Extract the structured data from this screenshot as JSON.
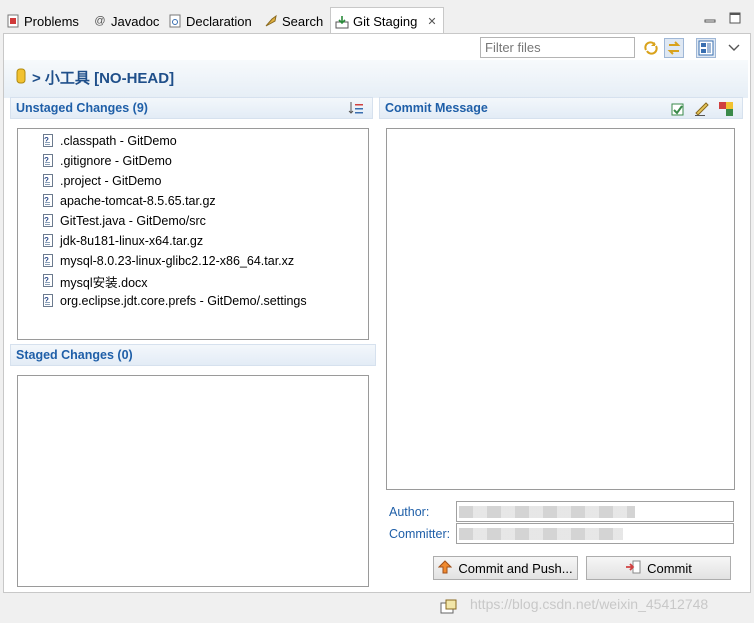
{
  "tabs": [
    {
      "label": "Problems",
      "icon": "problems-icon"
    },
    {
      "label": "Javadoc",
      "icon": "javadoc-icon"
    },
    {
      "label": "Declaration",
      "icon": "declaration-icon"
    },
    {
      "label": "Search",
      "icon": "search-icon"
    },
    {
      "label": "Git Staging",
      "icon": "git-staging-icon",
      "active": true
    }
  ],
  "filter": {
    "placeholder": "Filter files"
  },
  "repository": {
    "title": "> 小工具 [NO-HEAD]"
  },
  "unstaged": {
    "title": "Unstaged Changes (9)",
    "files": [
      ".classpath - GitDemo",
      ".gitignore - GitDemo",
      ".project - GitDemo",
      "apache-tomcat-8.5.65.tar.gz",
      "GitTest.java - GitDemo/src",
      "jdk-8u181-linux-x64.tar.gz",
      "mysql-8.0.23-linux-glibc2.12-x86_64.tar.xz",
      "mysql安装.docx",
      "org.eclipse.jdt.core.prefs - GitDemo/.settings"
    ]
  },
  "staged": {
    "title": "Staged Changes (0)"
  },
  "commit": {
    "title": "Commit Message",
    "author_label": "Author:",
    "committer_label": "Committer:",
    "commit_push_label": "Commit and Push...",
    "commit_label": "Commit"
  },
  "watermark": "https://blog.csdn.net/weixin_45412748",
  "colors": {
    "accent": "#1f5fa8",
    "title": "#1f4f8a"
  }
}
